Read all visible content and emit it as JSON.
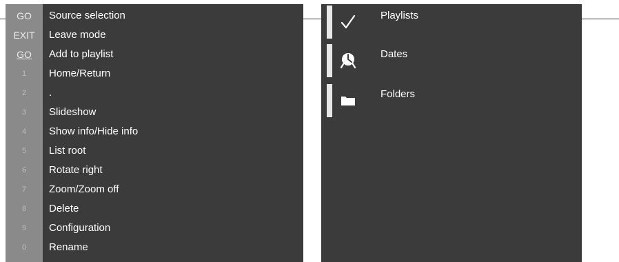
{
  "key_legend": [
    {
      "key": "GO",
      "function": "Source selection",
      "style": "normal"
    },
    {
      "key": "EXIT",
      "function": "Leave mode",
      "style": "normal"
    },
    {
      "key": "GO",
      "function": "Add to playlist",
      "style": "underline"
    },
    {
      "key": "1",
      "function": "Home/Return",
      "style": "dim"
    },
    {
      "key": "2",
      "function": ".",
      "style": "dim"
    },
    {
      "key": "3",
      "function": "Slideshow",
      "style": "dim"
    },
    {
      "key": "4",
      "function": "Show info/Hide info",
      "style": "dim"
    },
    {
      "key": "5",
      "function": "List root",
      "style": "dim"
    },
    {
      "key": "6",
      "function": "Rotate right",
      "style": "dim"
    },
    {
      "key": "7",
      "function": "Zoom/Zoom off",
      "style": "dim"
    },
    {
      "key": "8",
      "function": "Delete",
      "style": "dim"
    },
    {
      "key": "9",
      "function": "Configuration",
      "style": "dim"
    },
    {
      "key": "0",
      "function": "Rename",
      "style": "dim"
    }
  ],
  "menu": [
    {
      "label": "Playlists",
      "icon": "checkmark-icon"
    },
    {
      "label": "Dates",
      "icon": "clock-icon"
    },
    {
      "label": "Folders",
      "icon": "folder-icon"
    }
  ],
  "colors": {
    "panel_background": "#3b3b3b",
    "key_column": "#8a8a8a",
    "text": "#ffffff",
    "icon_frame": "#e9e9e9"
  }
}
